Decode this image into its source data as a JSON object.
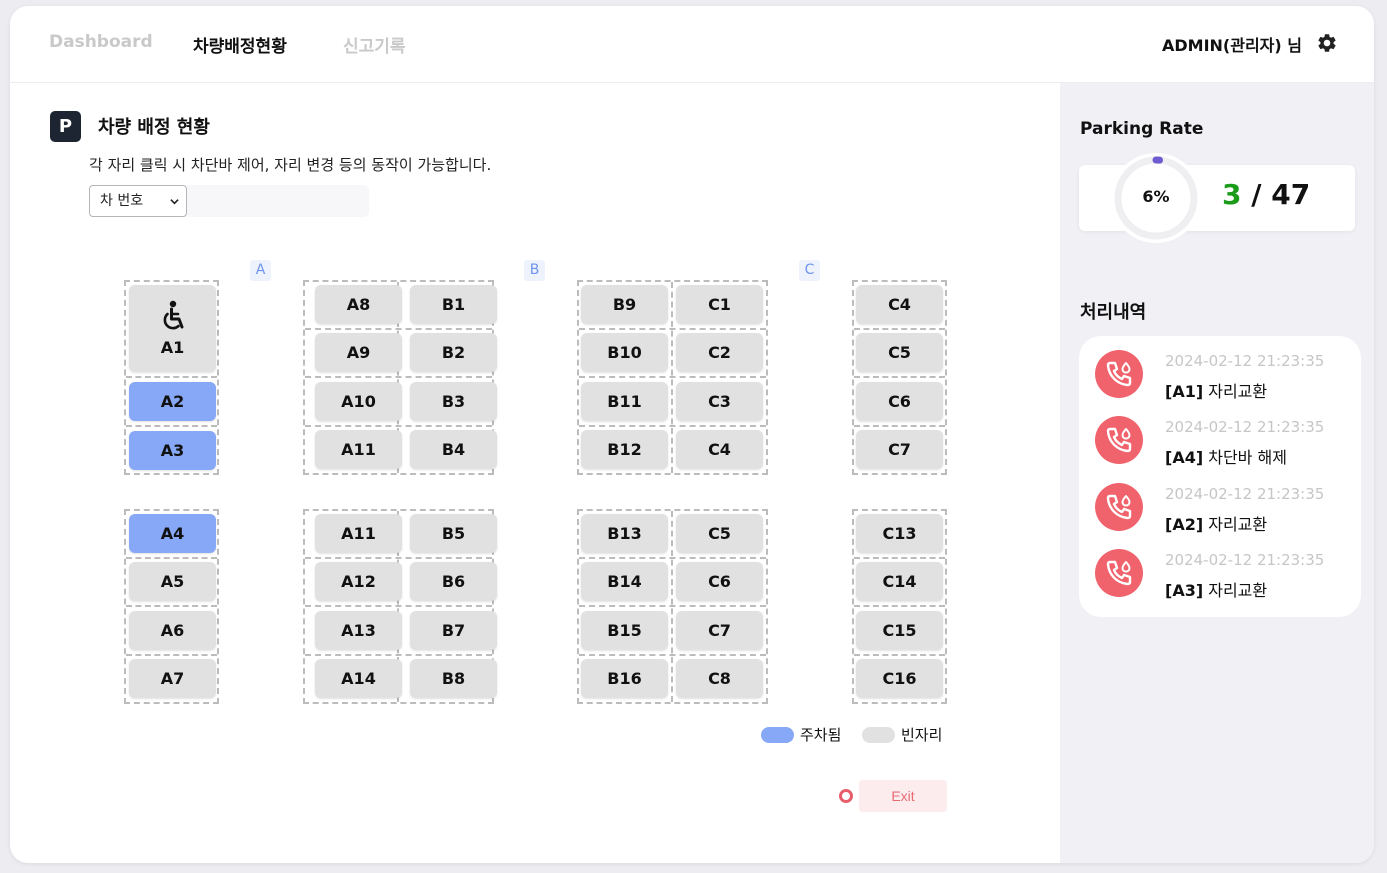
{
  "nav": {
    "tabs": [
      "Dashboard",
      "차량배정현황",
      "신고기록"
    ],
    "user": "ADMIN(관리자) 님"
  },
  "section": {
    "badge": "P",
    "title": "차량 배정 현황",
    "desc": "각 자리 클릭 시 차단바 제어, 자리 변경 등의 동작이 가능합니다.",
    "search_select": "차 번호",
    "search_value": ""
  },
  "zones": [
    "A",
    "B",
    "C"
  ],
  "spots": {
    "accessible": {
      "label": "A1",
      "icon": "wheelchair-icon"
    },
    "a_top": [
      "A2",
      "A3"
    ],
    "a_bottom": [
      "A4",
      "A5",
      "A6",
      "A7"
    ],
    "g2_top_left": [
      "A8",
      "A9",
      "A10",
      "A11"
    ],
    "g2_top_right": [
      "B1",
      "B2",
      "B3",
      "B4"
    ],
    "g2_bottom_left": [
      "A11",
      "A12",
      "A13",
      "A14"
    ],
    "g2_bottom_right": [
      "B5",
      "B6",
      "B7",
      "B8"
    ],
    "g3_top_left": [
      "B9",
      "B10",
      "B11",
      "B12"
    ],
    "g3_top_right": [
      "C1",
      "C2",
      "C3",
      "C4"
    ],
    "g3_bottom_left": [
      "B13",
      "B14",
      "B15",
      "B16"
    ],
    "g3_bottom_right": [
      "C5",
      "C6",
      "C7",
      "C8"
    ],
    "g4_top": [
      "C4",
      "C5",
      "C6",
      "C7"
    ],
    "g4_bottom": [
      "C13",
      "C14",
      "C15",
      "C16"
    ],
    "parked": [
      "A2",
      "A3",
      "A4"
    ]
  },
  "legend": {
    "parked": "주차됨",
    "empty": "빈자리"
  },
  "exit_label": "Exit",
  "rate": {
    "title": "Parking Rate",
    "percent_label": "6%",
    "percent_value": 6,
    "current": "3",
    "sep": " / ",
    "total": "47"
  },
  "history": {
    "title": "처리내역",
    "items": [
      {
        "time": "2024-02-12 21:23:35",
        "code": "[A1]",
        "action": " 자리교환"
      },
      {
        "time": "2024-02-12 21:23:35",
        "code": "[A4]",
        "action": " 차단바 해제"
      },
      {
        "time": "2024-02-12 21:23:35",
        "code": "[A2]",
        "action": " 자리교환"
      },
      {
        "time": "2024-02-12 21:23:35",
        "code": "[A3]",
        "action": " 자리교환"
      }
    ]
  },
  "colors": {
    "parked": "#86a8f6",
    "empty": "#e1e1e1",
    "accent_green": "#1a9c1a",
    "history_icon": "#f0636d",
    "exit": "#e85d6a"
  }
}
